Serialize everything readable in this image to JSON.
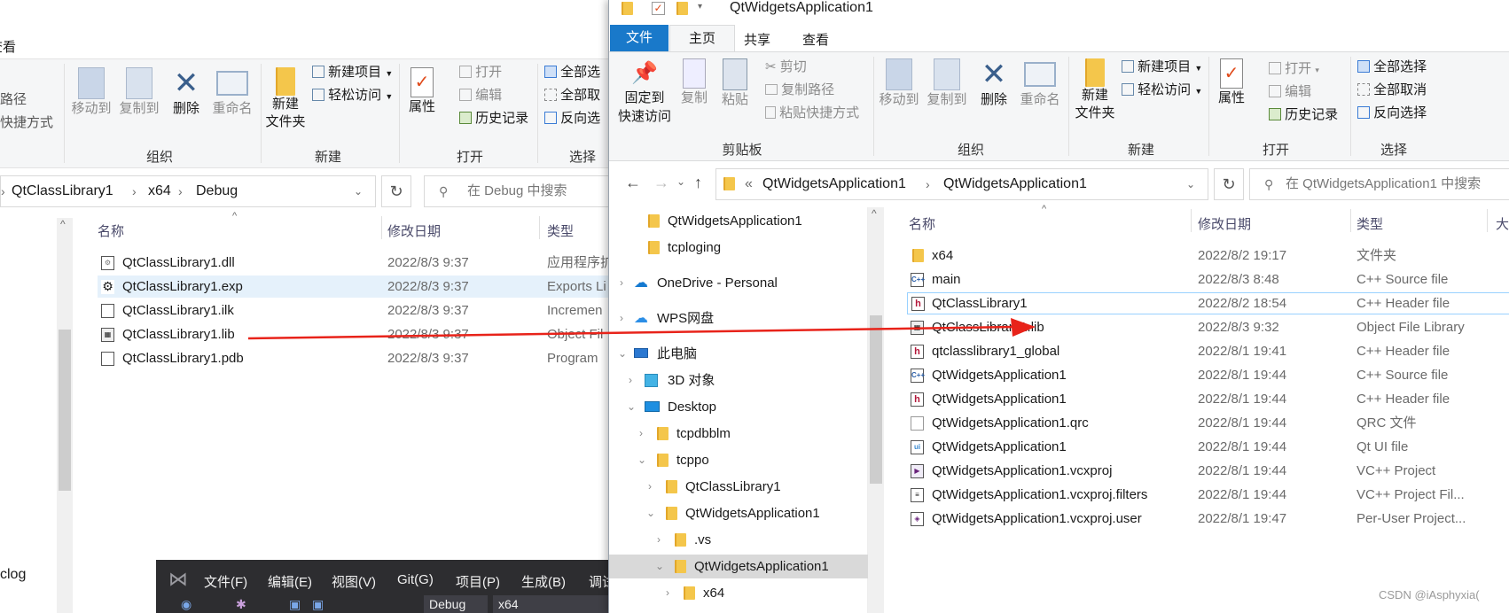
{
  "left": {
    "partial_tab": "查看",
    "partial_copy_path": "路径",
    "partial_paste_shortcut": "快捷方式",
    "organize": {
      "move_to": "移动到",
      "copy_to": "复制到",
      "delete": "删除",
      "rename": "重命名",
      "label": "组织"
    },
    "new": {
      "new_item": "新建项目",
      "easy_access": "轻松访问",
      "new_folder": "新建\n文件夹",
      "label": "新建"
    },
    "open": {
      "properties": "属性",
      "open": "打开",
      "edit": "编辑",
      "history": "历史记录",
      "label": "打开"
    },
    "select": {
      "select_all": "全部选",
      "select_none": "全部取",
      "invert": "反向选",
      "label": "选择"
    },
    "breadcrumb": [
      "QtClassLibrary1",
      "x64",
      "Debug"
    ],
    "search_placeholder": "在 Debug 中搜索",
    "columns": {
      "name": "名称",
      "date": "修改日期",
      "type": "类型"
    },
    "files": [
      {
        "name": "QtClassLibrary1.dll",
        "date": "2022/8/3 9:37",
        "type": "应用程序扩"
      },
      {
        "name": "QtClassLibrary1.exp",
        "date": "2022/8/3 9:37",
        "type": "Exports Li"
      },
      {
        "name": "QtClassLibrary1.ilk",
        "date": "2022/8/3 9:37",
        "type": "Incremen"
      },
      {
        "name": "QtClassLibrary1.lib",
        "date": "2022/8/3 9:37",
        "type": "Object Fil"
      },
      {
        "name": "QtClassLibrary1.pdb",
        "date": "2022/8/3 9:37",
        "type": "Program"
      }
    ],
    "bottom_item": "clog"
  },
  "vs": {
    "menu": [
      "文件(F)",
      "编辑(E)",
      "视图(V)",
      "Git(G)",
      "项目(P)",
      "生成(B)",
      "调试"
    ],
    "config": "Debug",
    "platform": "x64"
  },
  "right": {
    "title": "QtWidgetsApplication1",
    "tabs": [
      "文件",
      "主页",
      "共享",
      "查看"
    ],
    "clipboard": {
      "pin": "固定到\n快速访问",
      "copy": "复制",
      "paste": "粘贴",
      "cut": "剪切",
      "copy_path": "复制路径",
      "paste_shortcut": "粘贴快捷方式",
      "label": "剪贴板"
    },
    "organize": {
      "move_to": "移动到",
      "copy_to": "复制到",
      "delete": "删除",
      "rename": "重命名",
      "label": "组织"
    },
    "new": {
      "new_item": "新建项目",
      "easy_access": "轻松访问",
      "new_folder": "新建\n文件夹",
      "label": "新建"
    },
    "open": {
      "properties": "属性",
      "open": "打开",
      "edit": "编辑",
      "history": "历史记录",
      "label": "打开"
    },
    "select": {
      "select_all": "全部选择",
      "select_none": "全部取消",
      "invert": "反向选择",
      "label": "选择"
    },
    "address": [
      "«",
      "QtWidgetsApplication1",
      "QtWidgetsApplication1"
    ],
    "search_placeholder": "在 QtWidgetsApplication1 中搜索",
    "nav": [
      {
        "label": "QtWidgetsApplication1",
        "kind": "folder"
      },
      {
        "label": "tcploging",
        "kind": "folder"
      },
      {
        "label": "OneDrive - Personal",
        "kind": "cloud"
      },
      {
        "label": "WPS网盘",
        "kind": "cloud"
      },
      {
        "label": "此电脑",
        "kind": "pc"
      },
      {
        "label": "3D 对象",
        "kind": "3d"
      },
      {
        "label": "Desktop",
        "kind": "desktop"
      },
      {
        "label": "tcpdbblm",
        "kind": "folder"
      },
      {
        "label": "tcppo",
        "kind": "folder"
      },
      {
        "label": "QtClassLibrary1",
        "kind": "folder"
      },
      {
        "label": "QtWidgetsApplication1",
        "kind": "folder"
      },
      {
        "label": ".vs",
        "kind": "folder"
      },
      {
        "label": "QtWidgetsApplication1",
        "kind": "folder"
      },
      {
        "label": "x64",
        "kind": "folder"
      }
    ],
    "columns": {
      "name": "名称",
      "date": "修改日期",
      "type": "类型",
      "size": "大小"
    },
    "files": [
      {
        "name": "x64",
        "date": "2022/8/2 19:17",
        "type": "文件夹",
        "icon": "folder"
      },
      {
        "name": "main",
        "date": "2022/8/3 8:48",
        "type": "C++ Source file",
        "icon": "cpp"
      },
      {
        "name": "QtClassLibrary1",
        "date": "2022/8/2 18:54",
        "type": "C++ Header file",
        "icon": "h"
      },
      {
        "name": "QtClassLibrary1.lib",
        "date": "2022/8/3 9:32",
        "type": "Object File Library",
        "icon": "lib"
      },
      {
        "name": "qtclasslibrary1_global",
        "date": "2022/8/1 19:41",
        "type": "C++ Header file",
        "icon": "h"
      },
      {
        "name": "QtWidgetsApplication1",
        "date": "2022/8/1 19:44",
        "type": "C++ Source file",
        "icon": "cpp"
      },
      {
        "name": "QtWidgetsApplication1",
        "date": "2022/8/1 19:44",
        "type": "C++ Header file",
        "icon": "h"
      },
      {
        "name": "QtWidgetsApplication1.qrc",
        "date": "2022/8/1 19:44",
        "type": "QRC 文件",
        "icon": "file"
      },
      {
        "name": "QtWidgetsApplication1",
        "date": "2022/8/1 19:44",
        "type": "Qt UI file",
        "icon": "ui"
      },
      {
        "name": "QtWidgetsApplication1.vcxproj",
        "date": "2022/8/1 19:44",
        "type": "VC++ Project",
        "icon": "proj"
      },
      {
        "name": "QtWidgetsApplication1.vcxproj.filters",
        "date": "2022/8/1 19:44",
        "type": "VC++ Project Fil...",
        "icon": "proj"
      },
      {
        "name": "QtWidgetsApplication1.vcxproj.user",
        "date": "2022/8/1 19:47",
        "type": "Per-User Project...",
        "icon": "proj"
      }
    ]
  },
  "watermark": "CSDN @iAsphyxia("
}
